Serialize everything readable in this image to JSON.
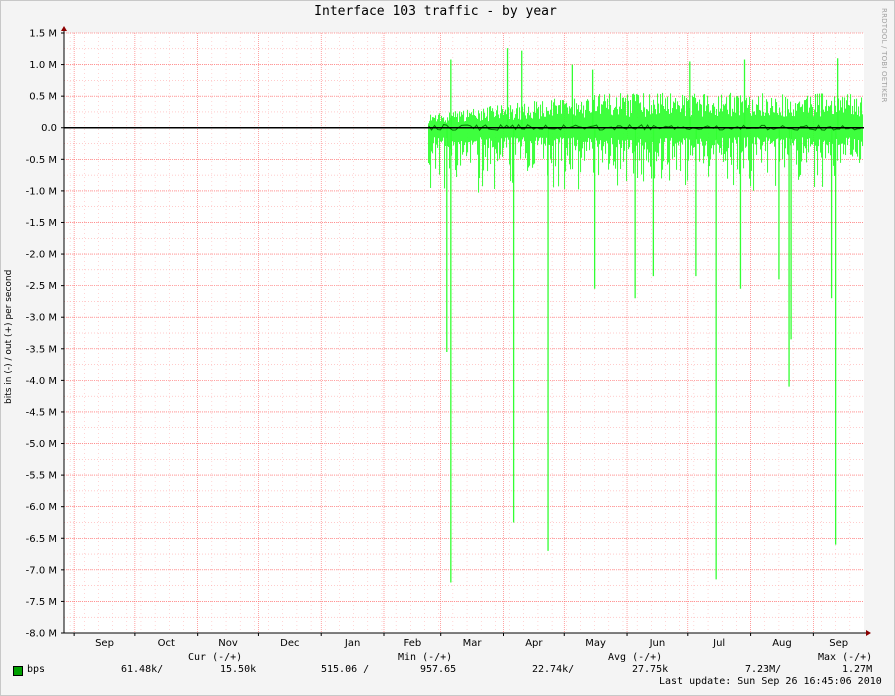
{
  "title": "Interface 103 traffic - by year",
  "watermark": "RRDTOOL / TOBI OETIKER",
  "legend": {
    "series_name": "bps",
    "headers": [
      "Cur (-/+)",
      "Min (-/+)",
      "Avg (-/+)",
      "Max (-/+)"
    ],
    "values": [
      "61.48k/",
      "15.50k",
      "515.06 /",
      "957.65",
      "22.74k/",
      "27.75k",
      "7.23M/",
      "1.27M"
    ],
    "last_update": "Last update: Sun Sep 26 16:45:06 2010"
  },
  "colors": {
    "fill": "#33ff33",
    "dark": "#008000",
    "swatch": "#00a000",
    "grid": "#ff9999",
    "grid_major": "#ff6666"
  },
  "chart_data": {
    "type": "area",
    "title": "Interface 103 traffic - by year",
    "ylabel": "bits in (-) / out (+) per second",
    "xlabel": "",
    "ylim": [
      -8000000,
      1500000
    ],
    "ytick_values": [
      1500000,
      1000000,
      500000,
      0,
      -500000,
      -1000000,
      -1500000,
      -2000000,
      -2500000,
      -3000000,
      -3500000,
      -4000000,
      -4500000,
      -5000000,
      -5500000,
      -6000000,
      -6500000,
      -7000000,
      -7500000,
      -8000000
    ],
    "ytick_labels": [
      "1.5 M",
      "1.0 M",
      "0.5 M",
      "0.0",
      "-0.5 M",
      "-1.0 M",
      "-1.5 M",
      "-2.0 M",
      "-2.5 M",
      "-3.0 M",
      "-3.5 M",
      "-4.0 M",
      "-4.5 M",
      "-5.0 M",
      "-5.5 M",
      "-6.0 M",
      "-6.5 M",
      "-7.0 M",
      "-7.5 M",
      "-8.0 M"
    ],
    "xlim": [
      "2009-08-27",
      "2010-09-26"
    ],
    "month_boundaries": [
      "2009-09-01",
      "2009-10-01",
      "2009-11-01",
      "2009-12-01",
      "2010-01-01",
      "2010-02-01",
      "2010-03-01",
      "2010-04-01",
      "2010-05-01",
      "2010-06-01",
      "2010-07-01",
      "2010-08-01",
      "2010-09-01"
    ],
    "xtick_labels": [
      "Sep",
      "Oct",
      "Nov",
      "Dec",
      "Jan",
      "Feb",
      "Mar",
      "Apr",
      "May",
      "Jun",
      "Jul",
      "Aug",
      "Sep"
    ],
    "data_start": "2010-02-23",
    "series": [
      {
        "name": "bps",
        "sign": "out (+)",
        "spikes": [
          {
            "x": "2010-03-06",
            "y": 1080000
          },
          {
            "x": "2010-04-03",
            "y": 1260000
          },
          {
            "x": "2010-04-10",
            "y": 1220000
          },
          {
            "x": "2010-05-05",
            "y": 1000000
          },
          {
            "x": "2010-05-15",
            "y": 920000
          },
          {
            "x": "2010-07-02",
            "y": 1050000
          },
          {
            "x": "2010-07-29",
            "y": 1080000
          },
          {
            "x": "2010-09-13",
            "y": 1100000
          }
        ],
        "typical_peak": 500000
      },
      {
        "name": "bps",
        "sign": "in (-)",
        "spikes": [
          {
            "x": "2010-03-04",
            "y": -3550000
          },
          {
            "x": "2010-03-06",
            "y": -7200000
          },
          {
            "x": "2010-04-06",
            "y": -6250000
          },
          {
            "x": "2010-04-23",
            "y": -6700000
          },
          {
            "x": "2010-05-16",
            "y": -2550000
          },
          {
            "x": "2010-06-05",
            "y": -2700000
          },
          {
            "x": "2010-06-14",
            "y": -2350000
          },
          {
            "x": "2010-07-05",
            "y": -2350000
          },
          {
            "x": "2010-07-15",
            "y": -7150000
          },
          {
            "x": "2010-07-27",
            "y": -2550000
          },
          {
            "x": "2010-08-15",
            "y": -2400000
          },
          {
            "x": "2010-08-20",
            "y": -4100000
          },
          {
            "x": "2010-08-21",
            "y": -3350000
          },
          {
            "x": "2010-09-10",
            "y": -2700000
          },
          {
            "x": "2010-09-12",
            "y": -6600000
          }
        ],
        "typical_trough": -1000000
      }
    ],
    "grid": true,
    "legend": "bottom"
  }
}
